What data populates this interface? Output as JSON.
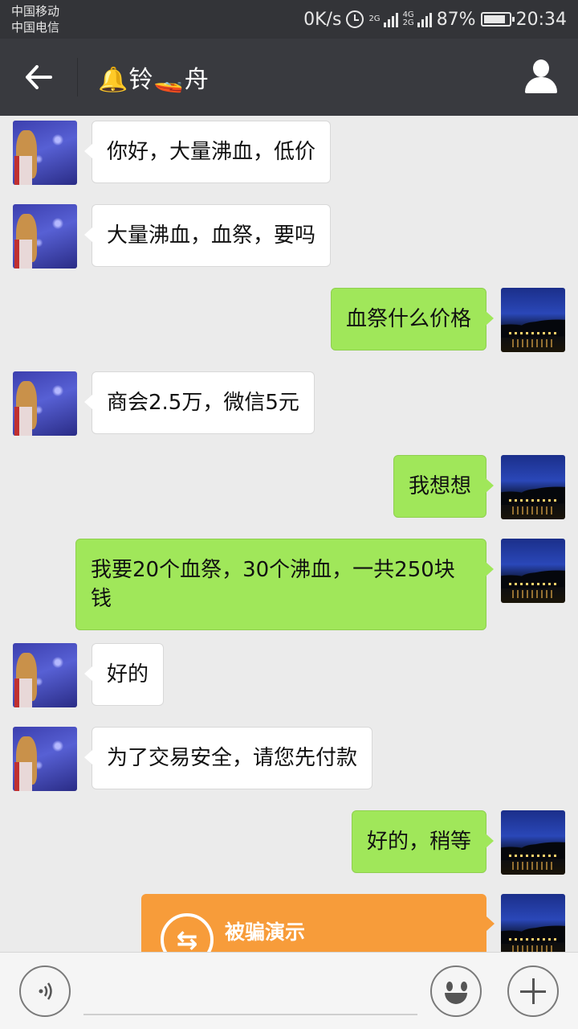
{
  "status_bar": {
    "carrier1": "中国移动",
    "carrier2": "中国电信",
    "net_speed": "0K/s",
    "sim1_label": "2G",
    "sim2_label_top": "4G",
    "sim2_label_bottom": "2G",
    "battery": "87%",
    "battery_level": 0.87,
    "time": "20:34"
  },
  "header": {
    "back_icon": "back-arrow-icon",
    "title": "🔔铃🚤舟",
    "profile_icon": "person-icon"
  },
  "messages": [
    {
      "side": "left",
      "text": "你好，大量沸血，低价"
    },
    {
      "side": "left",
      "text": "大量沸血，血祭，要吗"
    },
    {
      "side": "right",
      "text": "血祭什么价格"
    },
    {
      "side": "left",
      "text": "商会2.5万，微信5元"
    },
    {
      "side": "right",
      "text": "我想想"
    },
    {
      "side": "right",
      "text": "我要20个血祭，30个沸血，一共250块钱"
    },
    {
      "side": "left",
      "text": "好的"
    },
    {
      "side": "left",
      "text": "为了交易安全，请您先付款"
    },
    {
      "side": "right",
      "text": "好的，稍等"
    }
  ],
  "transfer_card": {
    "title": "被骗演示",
    "icon": "transfer-icon",
    "icon_glyph": "⇆",
    "color": "#f79c3a"
  },
  "input_bar": {
    "voice_icon": "voice-icon",
    "emoji_icon": "emoji-icon",
    "plus_icon": "plus-icon",
    "placeholder": ""
  },
  "colors": {
    "title_bar": "#393a3f",
    "status_bar": "#333438",
    "chat_bg": "#ebebeb",
    "own_bubble": "#a0e75a",
    "other_bubble": "#ffffff"
  }
}
